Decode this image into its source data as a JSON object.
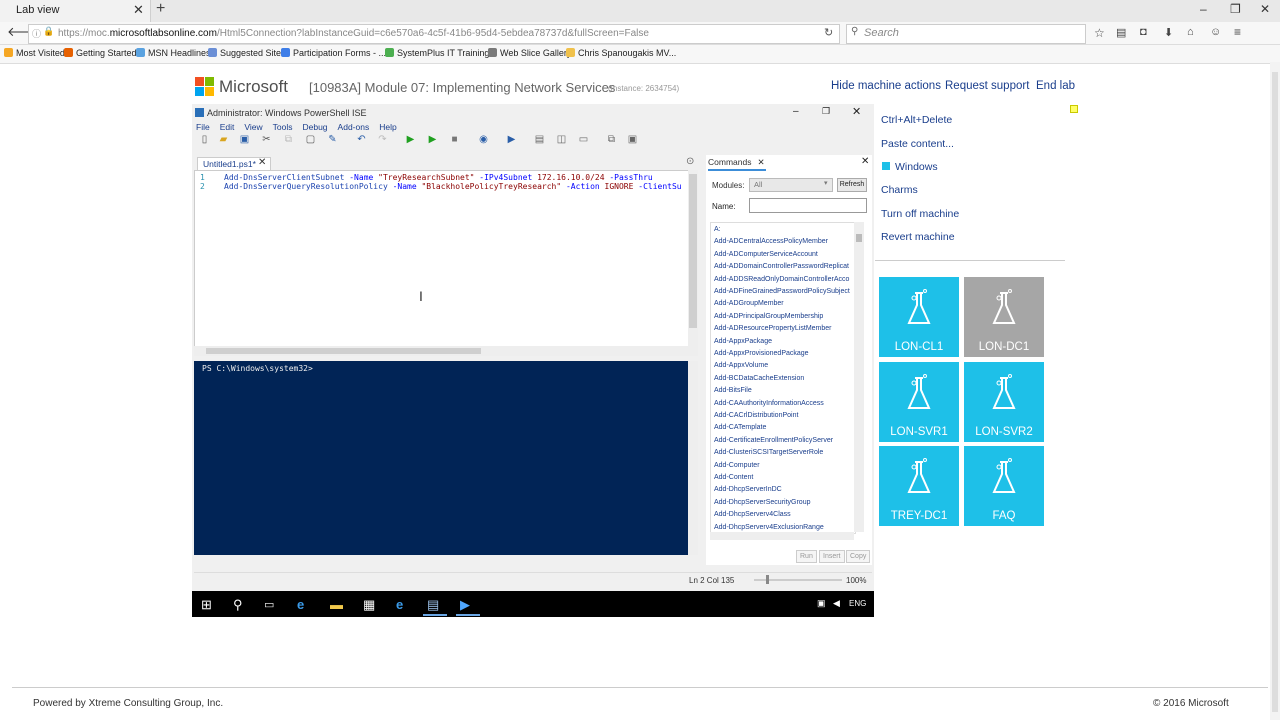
{
  "browser": {
    "tab_title": "Lab view",
    "url_prefix": "https://moc.",
    "url_domain": "microsoftlabsonline.com",
    "url_rest": "/Html5Connection?labInstanceGuid=c6e570a6-4c5f-41b6-95d4-5ebdea78737d&fullScreen=False",
    "search_placeholder": "Search",
    "bookmarks": [
      {
        "label": "Most Visited",
        "color": "#f5a623"
      },
      {
        "label": "Getting Started",
        "color": "#e66000"
      },
      {
        "label": "MSN Headlines",
        "color": "#5aa2e0"
      },
      {
        "label": "Suggested Sites",
        "color": "#6b8fd6"
      },
      {
        "label": "Participation Forms - ...",
        "color": "#3f7ee8"
      },
      {
        "label": "SystemPlus IT Training...",
        "color": "#4caf50"
      },
      {
        "label": "Web Slice Gallery",
        "color": "#7a7a7a"
      },
      {
        "label": "Chris Spanougakis MV...",
        "color": "#f0c14b"
      }
    ]
  },
  "header": {
    "brand": "Microsoft",
    "course_title": "[10983A] Module 07: Implementing Network Services",
    "instance": "(Instance: 2634754)",
    "links": [
      "Hide machine actions",
      "Request support",
      "End lab"
    ]
  },
  "ise": {
    "title": "Administrator: Windows PowerShell ISE",
    "menu": [
      "File",
      "Edit",
      "View",
      "Tools",
      "Debug",
      "Add-ons",
      "Help"
    ],
    "file_tab": "Untitled1.ps1*",
    "code_lines": [
      {
        "num": "1",
        "cmd": "Add-DnsServerClientSubnet",
        "p1": " -Name ",
        "s1": "\"TreyResearchSubnet\"",
        "p2": " -IPv4Subnet ",
        "s2": "172.16.10.0/24",
        "p3": " -PassThru",
        "s3": ""
      },
      {
        "num": "2",
        "cmd": "Add-DnsServerQueryResolutionPolicy",
        "p1": " -Name ",
        "s1": "\"BlackholePolicyTreyResearch\"",
        "p2": " -Action ",
        "s2": "IGNORE",
        "p3": " -ClientSu",
        "s3": ""
      }
    ],
    "prompt": "PS C:\\Windows\\system32>",
    "status": "Ln 2  Col 135",
    "zoom": "100%"
  },
  "commands": {
    "tab_label": "Commands",
    "modules_label": "Modules:",
    "modules_value": "All",
    "refresh_label": "Refresh",
    "name_label": "Name:",
    "items": [
      "A:",
      "Add-ADCentralAccessPolicyMember",
      "Add-ADComputerServiceAccount",
      "Add-ADDomainControllerPasswordReplicat",
      "Add-ADDSReadOnlyDomainControllerAcco",
      "Add-ADFineGrainedPasswordPolicySubject",
      "Add-ADGroupMember",
      "Add-ADPrincipalGroupMembership",
      "Add-ADResourcePropertyListMember",
      "Add-AppxPackage",
      "Add-AppxProvisionedPackage",
      "Add-AppxVolume",
      "Add-BCDataCacheExtension",
      "Add-BitsFile",
      "Add-CAAuthorityInformationAccess",
      "Add-CACrlDistributionPoint",
      "Add-CATemplate",
      "Add-CertificateEnrollmentPolicyServer",
      "Add-ClusteriSCSITargetServerRole",
      "Add-Computer",
      "Add-Content",
      "Add-DhcpServerInDC",
      "Add-DhcpServerSecurityGroup",
      "Add-DhcpServerv4Class",
      "Add-DhcpServerv4ExclusionRange"
    ],
    "buttons": [
      "Run",
      "Insert",
      "Copy"
    ]
  },
  "taskbar": {
    "lang": "ENG"
  },
  "machine_actions": [
    "Ctrl+Alt+Delete",
    "Paste content...",
    "Windows",
    "Charms",
    "Turn off machine",
    "Revert machine"
  ],
  "tiles": [
    {
      "label": "LON-CL1",
      "color": "#1ec0e8"
    },
    {
      "label": "LON-DC1",
      "color": "#a6a6a6"
    },
    {
      "label": "LON-SVR1",
      "color": "#1ec0e8"
    },
    {
      "label": "LON-SVR2",
      "color": "#1ec0e8"
    },
    {
      "label": "TREY-DC1",
      "color": "#1ec0e8"
    },
    {
      "label": "FAQ",
      "color": "#1ec0e8"
    }
  ],
  "footer": {
    "powered": "Powered by Xtreme Consulting Group, Inc.",
    "copyright": "© 2016 Microsoft"
  }
}
